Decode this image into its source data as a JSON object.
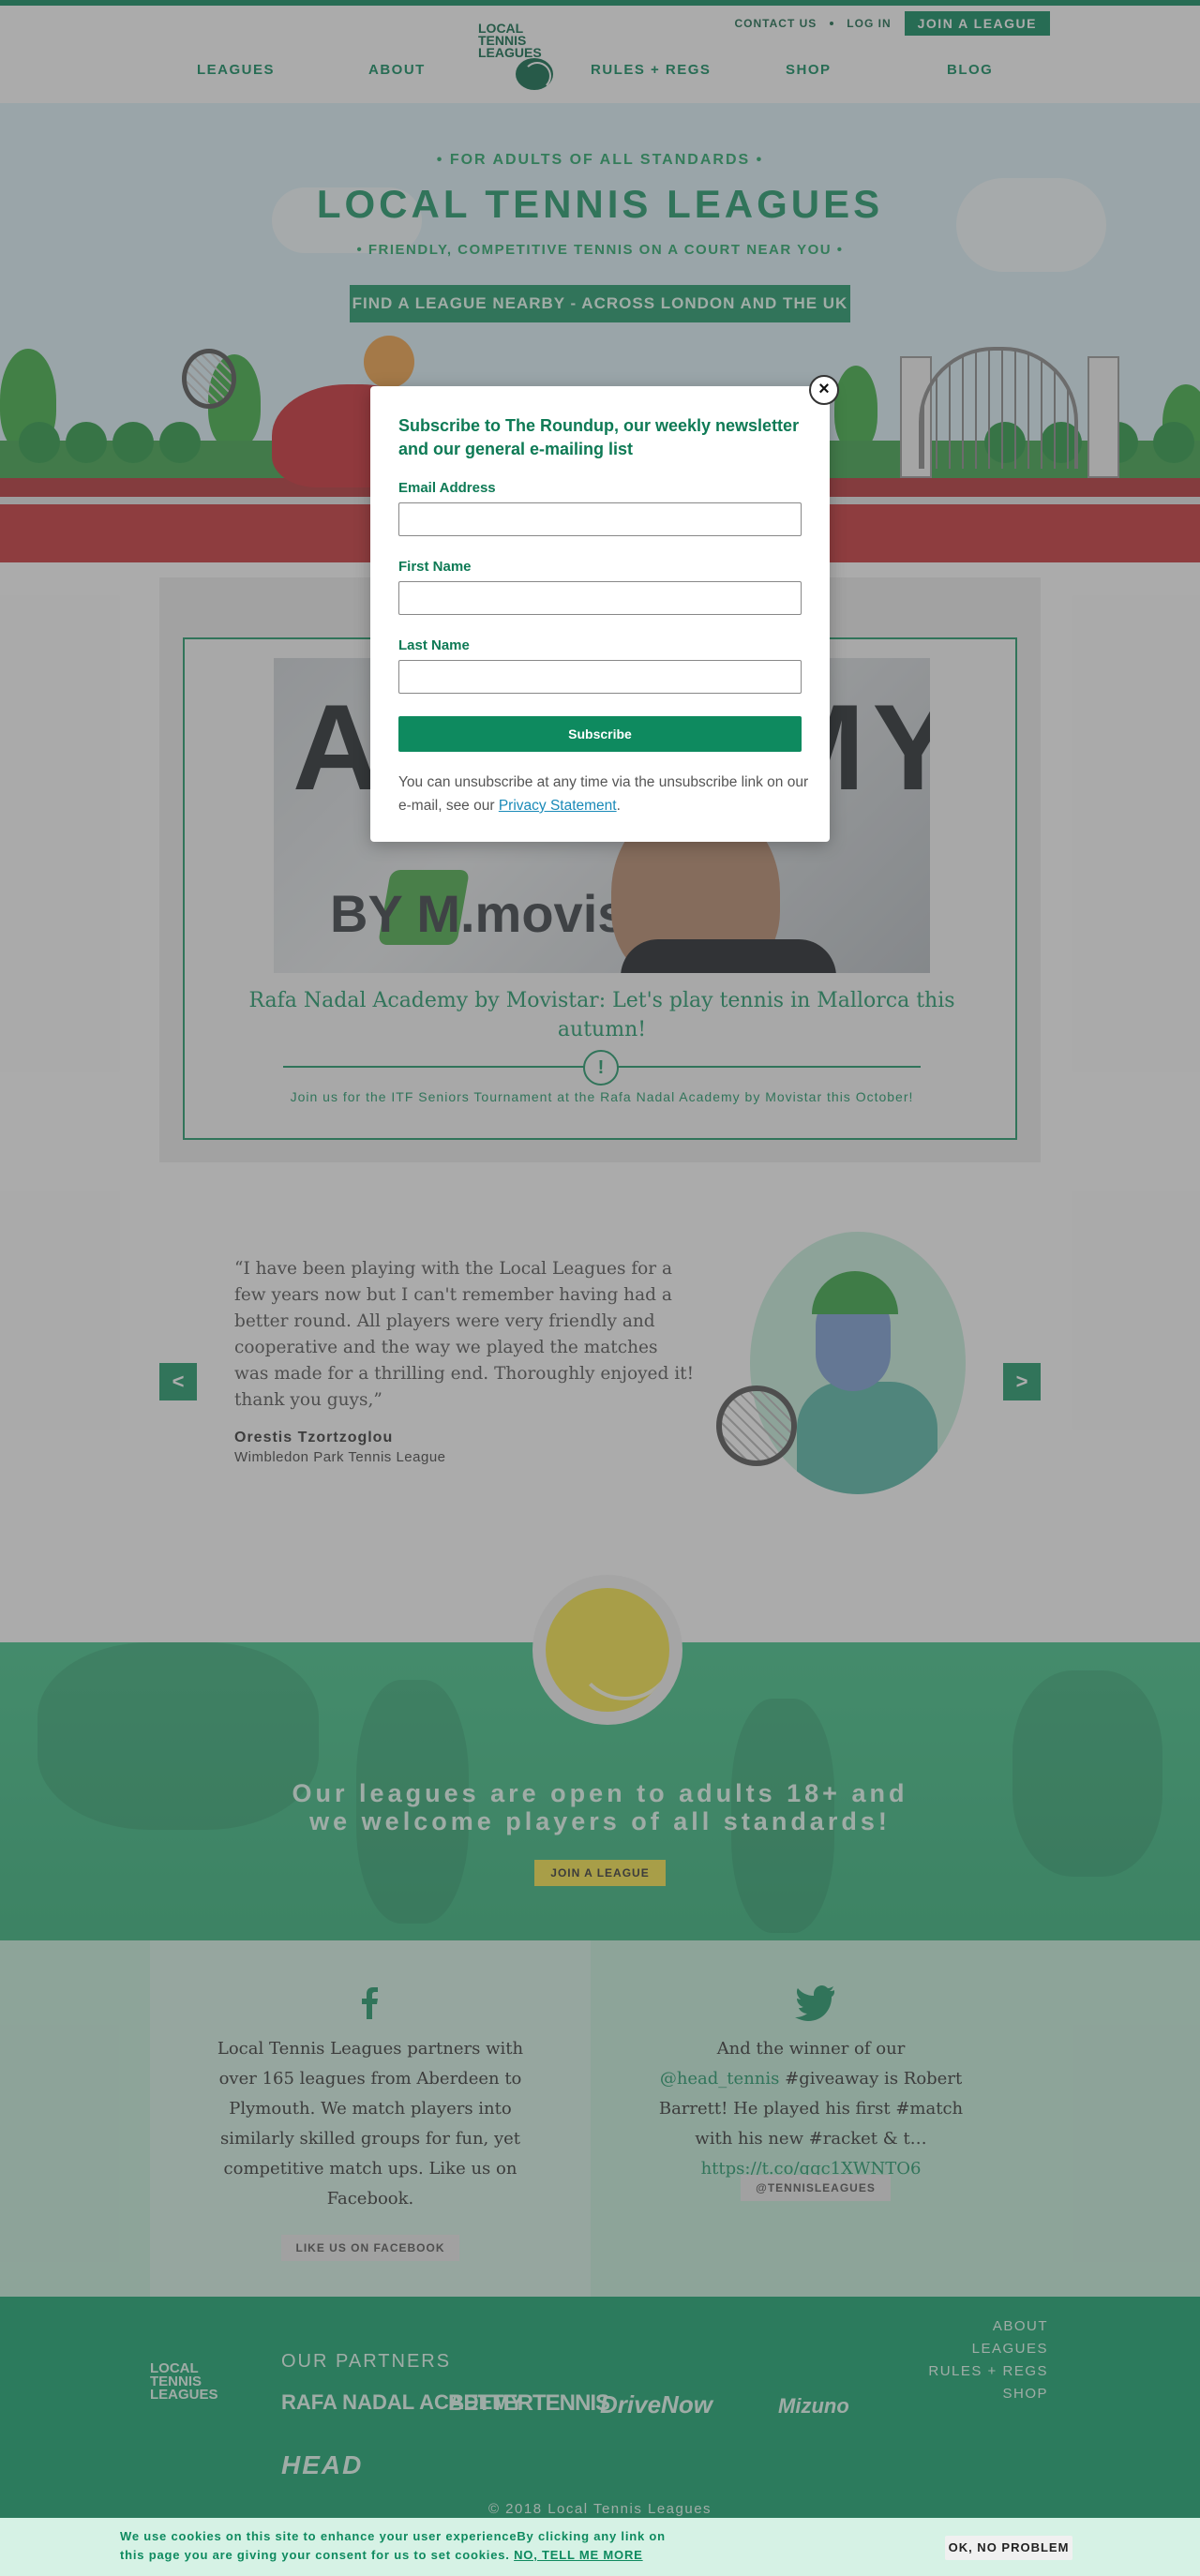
{
  "header": {
    "contact_label": "CONTACT US",
    "login_label": "LOG IN",
    "join_label": "JOIN A LEAGUE",
    "logo_text": [
      "LOCAL",
      "TENNIS",
      "LEAGUES"
    ],
    "nav": [
      {
        "label": "LEAGUES"
      },
      {
        "label": "ABOUT"
      },
      {
        "label": "RULES + REGS"
      },
      {
        "label": "SHOP"
      },
      {
        "label": "BLOG"
      }
    ]
  },
  "hero": {
    "tagline_top": "• FOR ADULTS OF ALL STANDARDS •",
    "title": "LOCAL TENNIS LEAGUES",
    "tagline_bottom": "• FRIENDLY, COMPETITIVE TENNIS ON A COURT NEAR YOU •",
    "cta_label": "FIND A LEAGUE NEARBY - ACROSS LONDON AND THE UK"
  },
  "feature": {
    "image_letters": "ACADEMY",
    "image_brand": "BY M.movist",
    "title": "Rafa Nadal Academy by Movistar: Let's play tennis in Mallorca this autumn!",
    "icon": "!",
    "description": "Join us for the ITF Seniors Tournament at the Rafa Nadal Academy by Movistar this October!"
  },
  "testimonial": {
    "prev_label": "<",
    "next_label": ">",
    "quote": "“I have been playing with the Local Leagues for a few years now but I can't remember having had a better round. All players were very friendly and cooperative and the way we played the matches was made for a thrilling end. Thoroughly enjoyed it! thank you guys,”",
    "author": "Orestis Tzortzoglou",
    "league": "Wimbledon Park Tennis League"
  },
  "band": {
    "text_line1": "Our leagues are open to adults 18+ and",
    "text_line2": "we welcome players of all standards!",
    "button_label": "JOIN A LEAGUE"
  },
  "social": {
    "facebook_text": "Local Tennis Leagues partners with over 165 leagues from Aberdeen to Plymouth. We match players into similarly skilled groups for fun, yet competitive match ups. Like us on Facebook.",
    "facebook_button": "LIKE US ON FACEBOOK",
    "twitter_pre": "And the winner of our ",
    "twitter_handle_link": "@head_tennis",
    "twitter_mid": " #giveaway is Robert Barrett! He played his first #match with his new #racket & t… ",
    "twitter_url": "https://t.co/qqc1XWNTO6",
    "twitter_button": "@TENNISLEAGUES"
  },
  "footer": {
    "logo_text": [
      "LOCAL",
      "TENNIS",
      "LEAGUES"
    ],
    "partners_label": "OUR PARTNERS",
    "partners": [
      "RAFA NADAL ACADEMY",
      "BETTERTENNIS",
      "DriveNow",
      "Mizuno",
      "HEAD"
    ],
    "nav": [
      "ABOUT",
      "LEAGUES",
      "RULES + REGS",
      "SHOP"
    ],
    "copyright": "© 2018 Local Tennis Leagues"
  },
  "modal": {
    "close_label": "×",
    "title": "Subscribe to The Roundup, our weekly newsletter and our general e-mailing list",
    "email_label": "Email Address",
    "email_value": "",
    "first_name_label": "First Name",
    "first_name_value": "",
    "last_name_label": "Last Name",
    "last_name_value": "",
    "subscribe_label": "Subscribe",
    "note_pre": "You can unsubscribe at any time via the unsubscribe link on our e-mail, see our ",
    "note_link": "Privacy Statement",
    "note_post": "."
  },
  "cookie": {
    "text": "We use cookies on this site to enhance your user experienceBy clicking any link on this page you are giving your consent for us to set cookies. ",
    "link": "NO, TELL ME MORE",
    "button": "OK, NO PROBLEM"
  },
  "colors": {
    "brand_green": "#0e8a5f",
    "light_green": "#1f9a6a",
    "mint": "#c7f0dd",
    "court_red": "#c8363a",
    "ball_yellow": "#f7e64a"
  },
  "icons": [
    "close-icon",
    "facebook-icon",
    "twitter-icon",
    "chevron-left-icon",
    "chevron-right-icon",
    "exclamation-icon",
    "tennis-ball-icon"
  ]
}
